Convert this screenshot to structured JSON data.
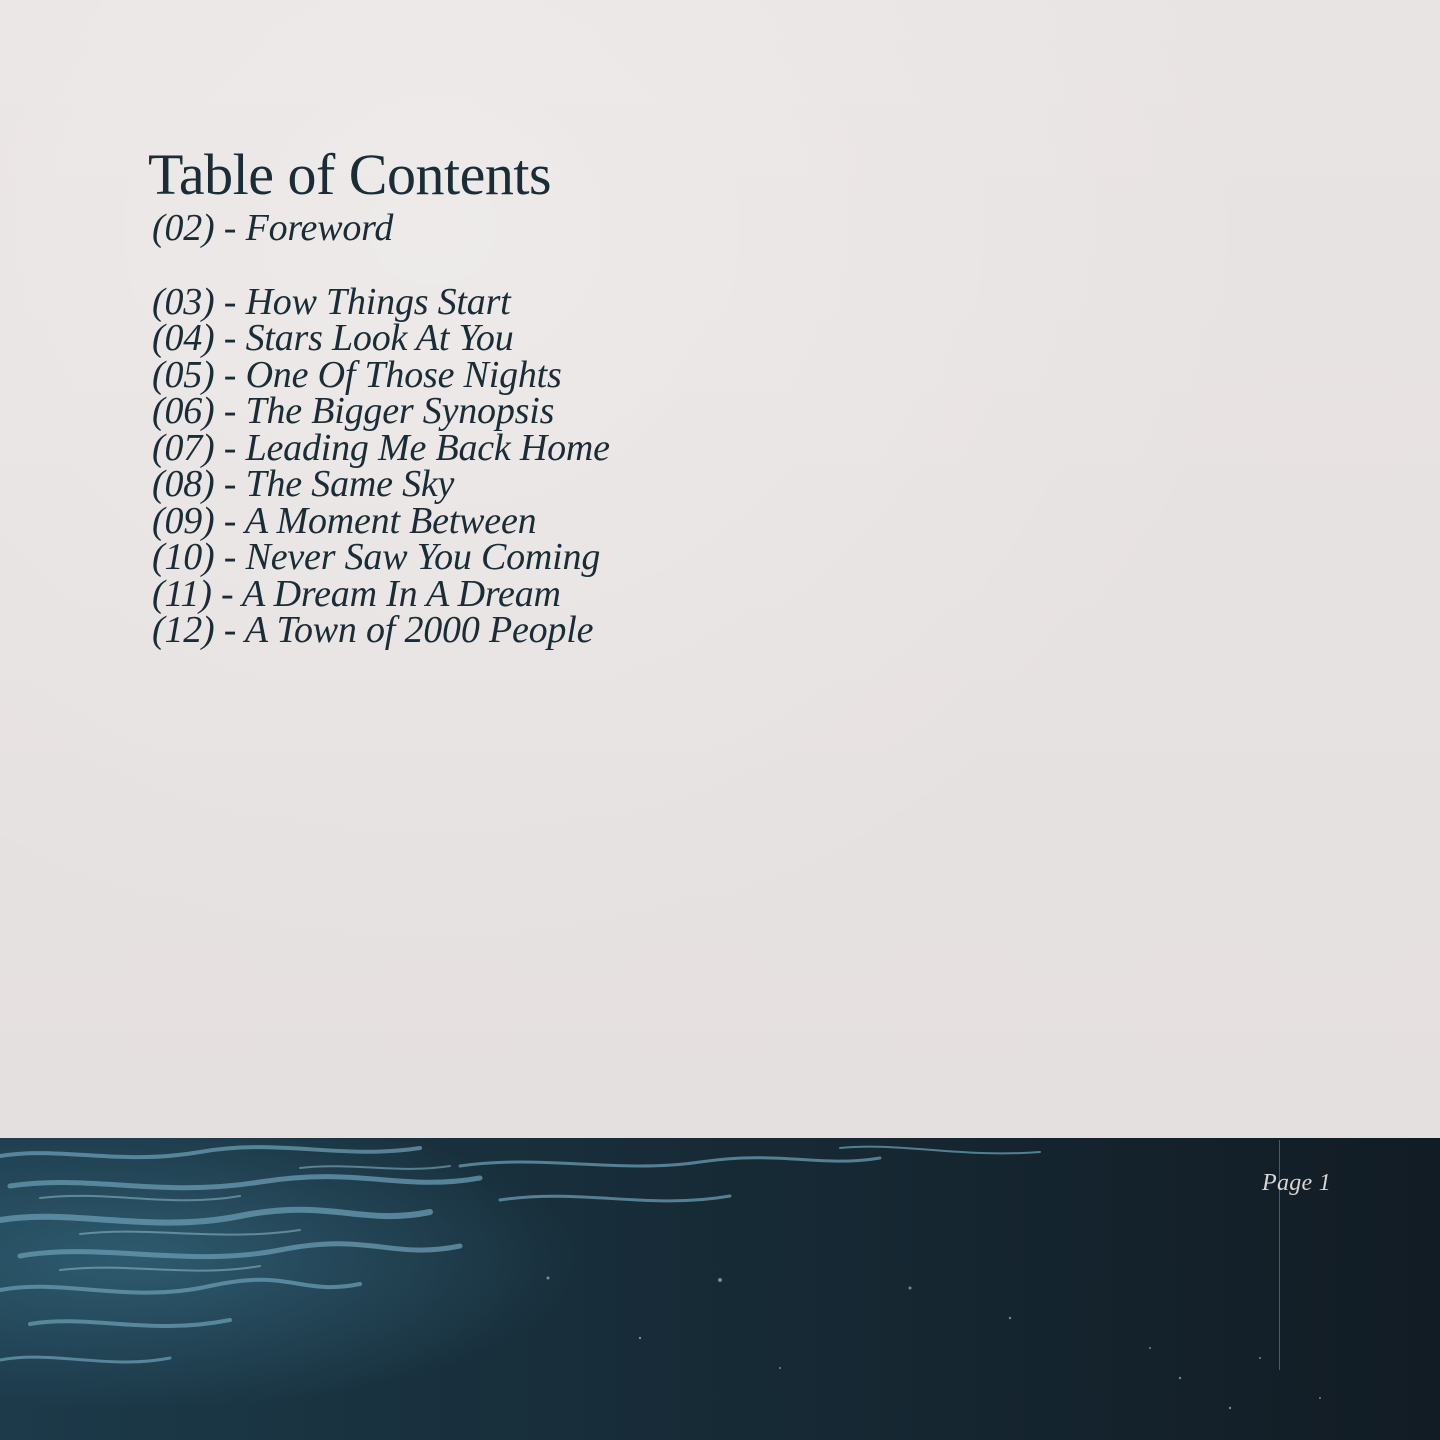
{
  "toc": {
    "title": "Table of Contents",
    "entries": [
      "(02) - Foreword",
      "(03) - How Things Start",
      "(04) - Stars Look At You",
      "(05) - One Of Those Nights",
      "(06) - The Bigger Synopsis",
      "(07) - Leading Me Back Home",
      "(08) - The Same Sky",
      "(09) - A Moment Between",
      "(10) - Never Saw You Coming",
      "(11) - A Dream In A Dream",
      "(12) - A Town of 2000 People"
    ]
  },
  "footer": {
    "page_label": "Page 1",
    "image": "dark-ocean-water-photo"
  },
  "colors": {
    "paper": "#e7e2e2",
    "ink": "#1a2c35",
    "ocean_dark": "#14212a",
    "wave_highlight": "#5d8fa6"
  }
}
